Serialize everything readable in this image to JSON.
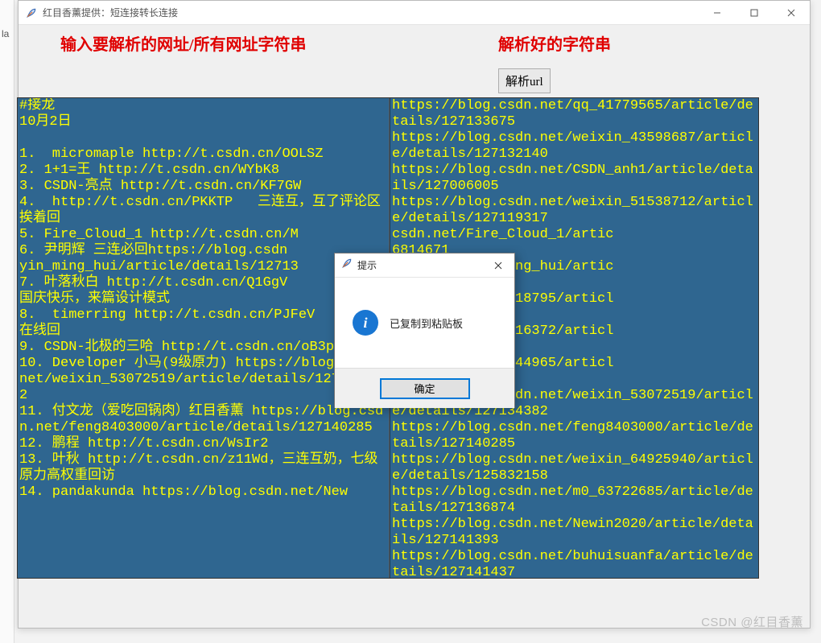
{
  "bg_frag": "la",
  "window": {
    "title": "红目香薰提供：短连接转长连接"
  },
  "labels": {
    "left": "输入要解析的网址/所有网址字符串",
    "right": "解析好的字符串"
  },
  "buttons": {
    "parse": "解析url"
  },
  "input_text": "#接龙\n10月2日\n\n1.  micromaple http://t.csdn.cn/OOLSZ\n2. 1+1=王 http://t.csdn.cn/WYbK8\n3. CSDN-亮点 http://t.csdn.cn/KF7GW\n4.  http://t.csdn.cn/PKKTP   三连互，互了评论区挨着回\n5. Fire_Cloud_1 http://t.csdn.cn/M\n6. 尹明辉 三连必回https://blog.csdn\nyin_ming_hui/article/details/12713\n7. 叶落秋白 http://t.csdn.cn/Q1GgV\n国庆快乐，来篇设计模式\n8.  timerring http://t.csdn.cn/PJFeV\n在线回\n9. CSDN-北极的三哈 http://t.csdn.cn/oB3pb\n10. Developer 小马(9级原力) https://blog.csdn.net/weixin_53072519/article/details/127134382\n11. 付文龙（爱吃回锅肉）红目香薰 https://blog.csdn.net/feng8403000/article/details/127140285\n12. 鹏程 http://t.csdn.cn/WsIr2\n13. 叶秋 http://t.csdn.cn/z11Wd，三连互奶，七级原力高权重回访\n14. pandakunda https://blog.csdn.net/New",
  "output_text": "https://blog.csdn.net/qq_41779565/article/details/127133675\nhttps://blog.csdn.net/weixin_43598687/article/details/127132140\nhttps://blog.csdn.net/CSDN_anh1/article/details/127006005\nhttps://blog.csdn.net/weixin_51538712/article/details/127119317\ncsdn.net/Fire_Cloud_1/artic\n6814671\ncsdn.net/yin_ming_hui/artic\n7133437\ncsdn.net/m0_58618795/articl\n132499\ncsdn.net/m0_52316372/articl\n134033\ncsdn.net/m0_68744965/articl\n113991\nhttps://blog.csdn.net/weixin_53072519/article/details/127134382\nhttps://blog.csdn.net/feng8403000/article/details/127140285\nhttps://blog.csdn.net/weixin_64925940/article/details/125832158\nhttps://blog.csdn.net/m0_63722685/article/details/127136874\nhttps://blog.csdn.net/Newin2020/article/details/127141393\nhttps://blog.csdn.net/buhuisuanfa/article/details/127141437",
  "dialog": {
    "title": "提示",
    "message": "已复制到粘贴板",
    "ok": "确定"
  },
  "watermark": "CSDN @红目香薰"
}
